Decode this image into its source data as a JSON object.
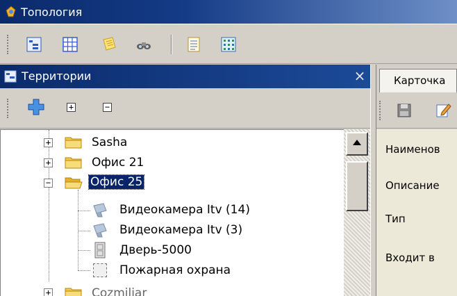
{
  "window": {
    "title": "Топология"
  },
  "toolbar": {
    "buttons": [
      {
        "icon": "tree-view-icon"
      },
      {
        "icon": "grid-icon"
      },
      {
        "icon": "notes-icon"
      },
      {
        "icon": "binoculars-icon"
      },
      {
        "icon": "document-icon"
      },
      {
        "icon": "map-grid-icon"
      }
    ]
  },
  "left_panel": {
    "title": "Территории",
    "close_glyph": "×",
    "tools": {
      "add_icon": "plus-cross-icon",
      "expand_glyph": "+",
      "collapse_glyph": "−"
    },
    "tree": [
      {
        "label": "Sasha",
        "expander": "+",
        "type": "folder",
        "level": 1
      },
      {
        "label": "Офис 21",
        "expander": "+",
        "type": "folder",
        "level": 1
      },
      {
        "label": "Офис 25",
        "expander": "−",
        "type": "folder",
        "level": 1,
        "selected": true
      },
      {
        "label": "Видеокамера Itv (14)",
        "type": "camera",
        "level": 2
      },
      {
        "label": "Видеокамера Itv (3)",
        "type": "camera",
        "level": 2
      },
      {
        "label": "Дверь-5000",
        "type": "door",
        "level": 2
      },
      {
        "label": "Пожарная охрана",
        "type": "fire-zone",
        "level": 2
      },
      {
        "label": "Cozmiliar",
        "expander": "+",
        "type": "folder",
        "level": 1
      }
    ]
  },
  "right_panel": {
    "tab": "Карточка",
    "tools": {
      "save_icon": "floppy-disk-icon",
      "edit_icon": "pencil-icon"
    },
    "fields": [
      {
        "label": "Наименов"
      },
      {
        "label": "Описание"
      },
      {
        "label": "Тип"
      },
      {
        "label": "Входит в"
      }
    ]
  },
  "colors": {
    "titlebar": "#0b2a6b",
    "selection": "#0a246a",
    "folder": "#f2c94c",
    "chrome": "#d4d0c8"
  }
}
